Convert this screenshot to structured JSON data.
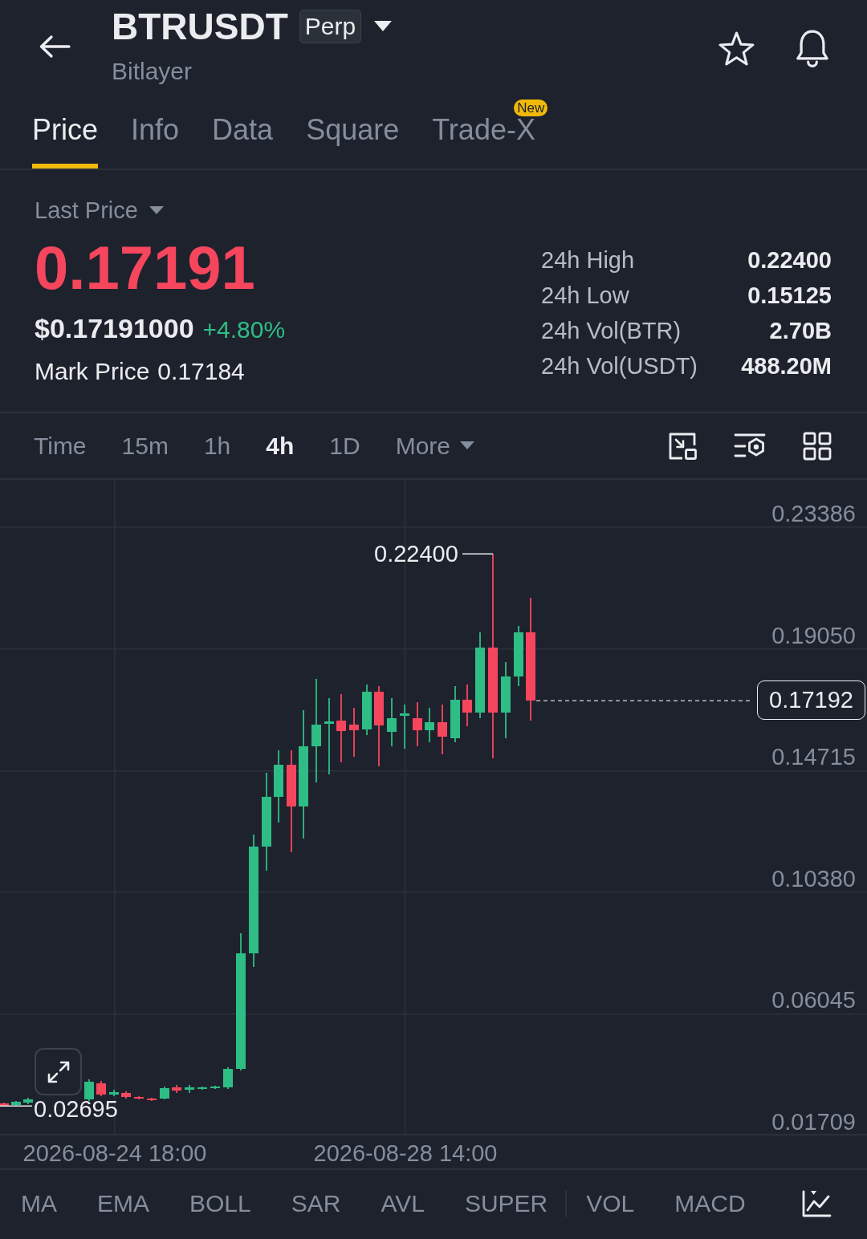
{
  "header": {
    "title": "BTRUSDT",
    "badge": "Perp",
    "subtitle": "Bitlayer"
  },
  "tabs": [
    {
      "label": "Price",
      "selected": true
    },
    {
      "label": "Info",
      "selected": false
    },
    {
      "label": "Data",
      "selected": false
    },
    {
      "label": "Square",
      "selected": false
    },
    {
      "label": "Trade-X",
      "selected": false,
      "badge": "New"
    }
  ],
  "price": {
    "selector": "Last Price",
    "last": "0.17191",
    "last_falling": true,
    "usd": "$0.17191000",
    "change": "+4.80%",
    "change_rising": true,
    "mark_label": "Mark Price",
    "mark_value": "0.17184"
  },
  "stats": [
    {
      "label": "24h High",
      "value": "0.22400"
    },
    {
      "label": "24h Low",
      "value": "0.15125"
    },
    {
      "label": "24h Vol(BTR)",
      "value": "2.70B"
    },
    {
      "label": "24h Vol(USDT)",
      "value": "488.20M"
    }
  ],
  "intervals": [
    {
      "label": "Time",
      "kind": "option",
      "selected": false
    },
    {
      "label": "15m",
      "kind": "option",
      "selected": false
    },
    {
      "label": "1h",
      "kind": "option",
      "selected": false
    },
    {
      "label": "4h",
      "kind": "option",
      "selected": true
    },
    {
      "label": "1D",
      "kind": "option",
      "selected": false
    },
    {
      "label": "More",
      "kind": "menu",
      "selected": false
    }
  ],
  "chart": {
    "y_axis_labels": [
      "0.23386",
      "0.19050",
      "0.14715",
      "0.10380",
      "0.06045",
      "0.01709"
    ],
    "x_axis_labels": [
      "2026-08-24 18:00",
      "2026-08-28 14:00"
    ],
    "current_price": "0.17192",
    "high_label": "0.22400",
    "low_label": "0.02695"
  },
  "indicator_groups": [
    [
      "MA",
      "EMA",
      "BOLL",
      "SAR",
      "AVL",
      "SUPER"
    ],
    [
      "VOL",
      "MACD"
    ]
  ]
}
